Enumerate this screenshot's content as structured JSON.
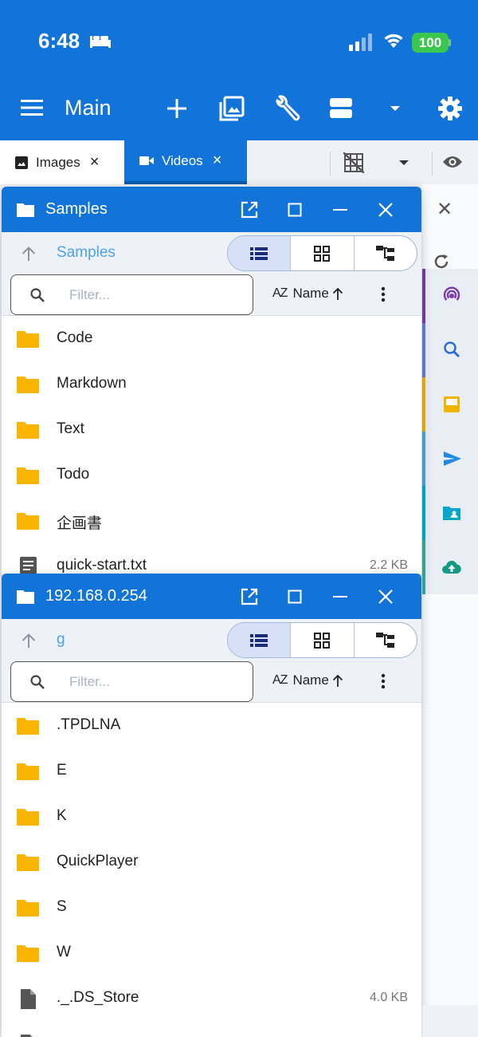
{
  "status_bar": {
    "time": "6:48",
    "battery": "100"
  },
  "appbar": {
    "title": "Main"
  },
  "tabs": [
    {
      "label": "Images",
      "icon": "image-icon",
      "active": false
    },
    {
      "label": "Videos",
      "icon": "video-icon",
      "active": true
    }
  ],
  "side_rail": {
    "items": [
      {
        "icon": "podcast-icon",
        "color": "#7b3fa8"
      },
      {
        "icon": "search-icon",
        "color": "#2a6fd0"
      },
      {
        "icon": "inbox-icon",
        "color": "#f0b400"
      },
      {
        "icon": "send-icon",
        "color": "#1e88e5"
      },
      {
        "icon": "folder-shared-icon",
        "color": "#00a7c9"
      },
      {
        "icon": "cloud-upload-icon",
        "color": "#129a85"
      }
    ]
  },
  "windows": [
    {
      "title": "Samples",
      "path": "Samples",
      "filter_placeholder": "Filter...",
      "sort": {
        "az": "AZ",
        "label": "Name"
      },
      "files": [
        {
          "name": "Code",
          "type": "folder",
          "size": ""
        },
        {
          "name": "Markdown",
          "type": "folder",
          "size": ""
        },
        {
          "name": "Text",
          "type": "folder",
          "size": ""
        },
        {
          "name": "Todo",
          "type": "folder",
          "size": ""
        },
        {
          "name": "企画書",
          "type": "folder",
          "size": ""
        },
        {
          "name": "quick-start.txt",
          "type": "text",
          "size": "2.2 KB"
        }
      ]
    },
    {
      "title": "192.168.0.254",
      "path": "g",
      "filter_placeholder": "Filter...",
      "sort": {
        "az": "AZ",
        "label": "Name"
      },
      "files": [
        {
          "name": ".TPDLNA",
          "type": "folder",
          "size": ""
        },
        {
          "name": "E",
          "type": "folder",
          "size": ""
        },
        {
          "name": "K",
          "type": "folder",
          "size": ""
        },
        {
          "name": "QuickPlayer",
          "type": "folder",
          "size": ""
        },
        {
          "name": "S",
          "type": "folder",
          "size": ""
        },
        {
          "name": "W",
          "type": "folder",
          "size": ""
        },
        {
          "name": "._.DS_Store",
          "type": "file",
          "size": "4.0 KB"
        }
      ]
    }
  ],
  "colors": {
    "primary": "#1274d8",
    "folder": "#f9b500",
    "accent_light": "#4aa3e8"
  }
}
